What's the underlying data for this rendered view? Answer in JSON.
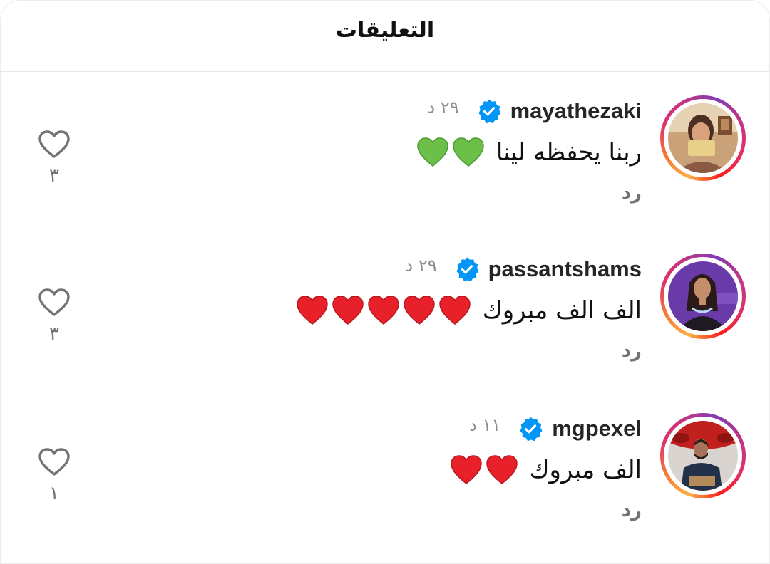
{
  "header": {
    "title": "التعليقات"
  },
  "comments": [
    {
      "username": "mayathezaki",
      "verified": true,
      "time": "٢٩ د",
      "text": "ربنا يحفظه لينا",
      "emoji": [
        "green-heart",
        "green-heart"
      ],
      "reply_label": "رد",
      "likes": "٣"
    },
    {
      "username": "passantshams",
      "verified": true,
      "time": "٢٩ د",
      "text": "الف الف مبروك",
      "emoji": [
        "red-heart",
        "red-heart",
        "red-heart",
        "red-heart",
        "red-heart"
      ],
      "reply_label": "رد",
      "likes": "٣"
    },
    {
      "username": "mgpexel",
      "verified": true,
      "time": "١١ د",
      "text": "الف مبروك",
      "emoji": [
        "red-heart",
        "red-heart"
      ],
      "reply_label": "رد",
      "likes": "١"
    }
  ],
  "colors": {
    "verified": "#0095f6",
    "green_heart": "#6cc04a",
    "red_heart": "#e8202a",
    "muted": "#737373"
  }
}
